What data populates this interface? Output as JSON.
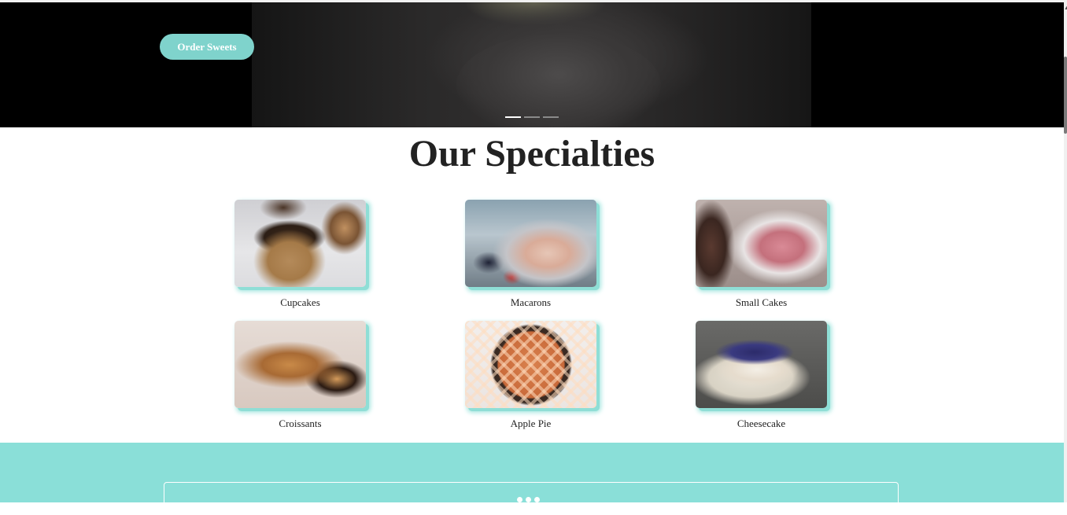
{
  "hero": {
    "cta_label": "Order Sweets",
    "slides_total": 3,
    "active_slide": 1
  },
  "specialties": {
    "title": "Our Specialties",
    "items": [
      {
        "label": "Cupcakes"
      },
      {
        "label": "Macarons"
      },
      {
        "label": "Small Cakes"
      },
      {
        "label": "Croissants"
      },
      {
        "label": "Apple Pie"
      },
      {
        "label": "Cheesecake"
      }
    ]
  },
  "colors": {
    "accent": "#7fd3cc",
    "band": "#8adfd8",
    "hero_bg": "#000000",
    "title": "#222222"
  }
}
